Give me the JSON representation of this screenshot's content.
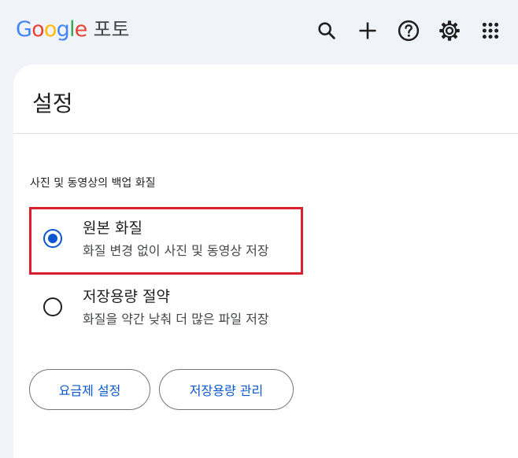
{
  "app": {
    "logo_letters": [
      "G",
      "o",
      "o",
      "g",
      "l",
      "e"
    ],
    "logo_colors": [
      "#4285f4",
      "#ea4335",
      "#fbbc05",
      "#4285f4",
      "#34a853",
      "#ea4335"
    ],
    "product_name": "포토"
  },
  "toolbar": {
    "icons": [
      "search-icon",
      "plus-icon",
      "help-icon",
      "settings-gear-icon",
      "apps-grid-icon"
    ]
  },
  "page": {
    "title": "설정"
  },
  "backup_quality": {
    "section_label": "사진 및 동영상의 백업 화질",
    "options": [
      {
        "title": "원본 화질",
        "description": "화질 변경 없이 사진 및 동영상 저장",
        "selected": true,
        "highlighted": true
      },
      {
        "title": "저장용량 절약",
        "description": "화질을 약간 낮춰 더 많은 파일 저장",
        "selected": false,
        "highlighted": false
      }
    ]
  },
  "buttons": {
    "plan_settings": "요금제 설정",
    "manage_storage": "저장용량 관리"
  },
  "colors": {
    "accent": "#0b57d0",
    "highlight_border": "#d8202e",
    "background": "#f0f4f9",
    "card": "#ffffff"
  }
}
